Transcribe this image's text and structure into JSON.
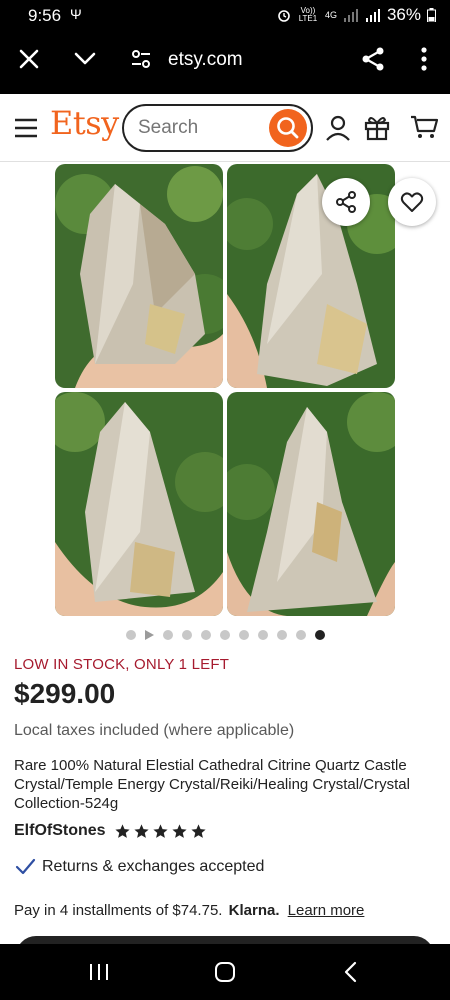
{
  "status_bar": {
    "time": "9:56",
    "usb_glyph": "Ψ",
    "network": "4G",
    "volte": "Vo)) LTE1",
    "battery": "36%"
  },
  "browser": {
    "url": "etsy.com"
  },
  "header": {
    "logo": "Etsy",
    "search_placeholder": "Search",
    "accent_color": "#F1641E"
  },
  "gallery": {
    "dot_count": 10,
    "active_index": 9
  },
  "listing": {
    "stock_notice": "LOW IN STOCK, ONLY 1 LEFT",
    "price": "$299.00",
    "taxes_note": "Local taxes included (where applicable)",
    "title": "Rare 100% Natural Elestial Cathedral Citrine Quartz Castle Crystal/Temple Energy Crystal/Reiki/Healing Crystal/Crystal Collection-524g",
    "shop_name": "ElfOfStones",
    "rating_stars": 5,
    "returns": "Returns & exchanges accepted",
    "installments": "Pay in 4 installments of $74.75.",
    "klarna": "Klarna.",
    "learn_more": "Learn more"
  },
  "icons": {
    "close": "close-icon",
    "chevron": "chevron-down-icon",
    "tune": "site-settings-icon",
    "share": "share-icon",
    "menu": "more-vert-icon",
    "hamburger": "hamburger-icon",
    "search": "search-icon",
    "user": "user-icon",
    "gift": "gift-icon",
    "cart": "cart-icon",
    "heart": "heart-icon",
    "star": "star-icon",
    "check": "check-icon"
  }
}
